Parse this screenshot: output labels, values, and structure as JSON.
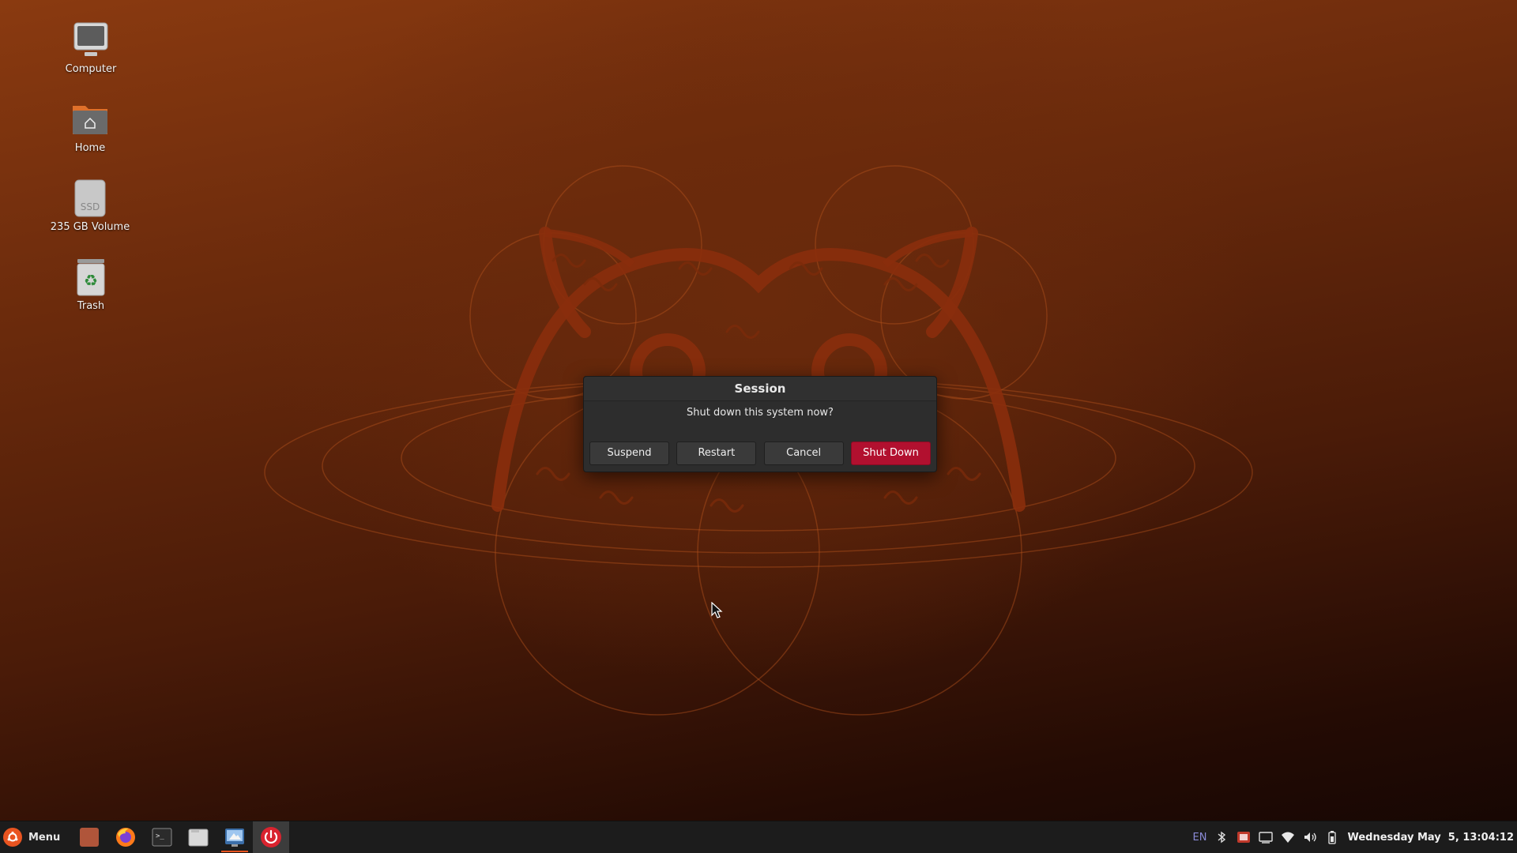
{
  "desktop": {
    "icons": [
      {
        "label": "Computer",
        "icon": "computer-icon"
      },
      {
        "label": "Home",
        "icon": "home-folder-icon"
      },
      {
        "label": "235 GB Volume",
        "icon": "ssd-drive-icon",
        "badge": "SSD"
      },
      {
        "label": "Trash",
        "icon": "trash-icon"
      }
    ]
  },
  "dialog": {
    "title": "Session",
    "message": "Shut down this system now?",
    "buttons": {
      "suspend": "Suspend",
      "restart": "Restart",
      "cancel": "Cancel",
      "shutdown": "Shut Down"
    },
    "accent_color": "#b2102f"
  },
  "taskbar": {
    "menu_label": "Menu",
    "launchers": [
      "desktop-show-icon",
      "firefox-icon",
      "terminal-icon",
      "files-icon",
      "system-tool-icon",
      "power-icon"
    ],
    "tray": {
      "language": "EN",
      "clock": "Wednesday May  5, 13:04:12",
      "icons": [
        "bluetooth-icon",
        "update-icon",
        "display-icon",
        "wifi-icon",
        "volume-icon",
        "battery-icon"
      ]
    },
    "accent_color": "#e95420"
  }
}
